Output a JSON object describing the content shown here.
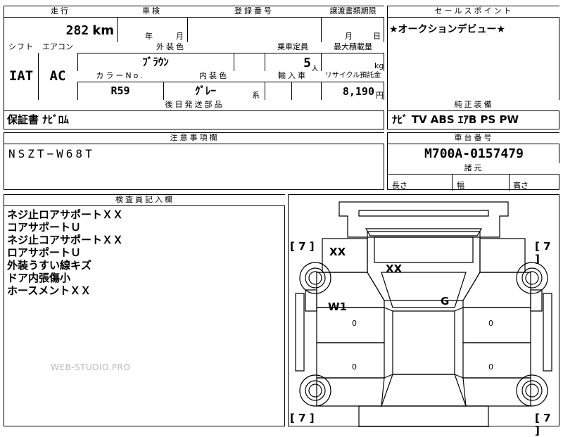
{
  "vehicle": {
    "headers": {
      "mileage": "走行",
      "inspection": "車検",
      "registration": "登録番号",
      "transfer": "譲渡書類期限",
      "shift": "シフト",
      "aircon": "エアコン",
      "exterior_color": "外装色",
      "capacity": "乗車定員",
      "max_load": "最大積載量",
      "color_no": "カラーNo.",
      "interior_color": "内装色",
      "import": "輸入車",
      "recycle": "リサイクル預託金",
      "later_parts": "後日発送部品"
    },
    "mileage": "282",
    "mileage_unit": "km",
    "inspection_year": "年",
    "inspection_month": "月",
    "transfer_month": "月",
    "transfer_day": "日",
    "shift": "IAT",
    "aircon": "AC",
    "exterior_color": "ﾌﾞﾗｳﾝ",
    "capacity": "5",
    "capacity_unit": "人",
    "load_unit": "kg",
    "color_no": "R59",
    "interior_color": "ｸﾞﾚｰ",
    "interior_suffix": "系",
    "recycle": "8,190",
    "recycle_unit": "円",
    "later_parts": "保証書 ﾅﾋﾞﾛﾑ"
  },
  "sales_point": {
    "header": "セールスポイント",
    "text": "★オークションデビュー★"
  },
  "equipment": {
    "header": "純正装備",
    "text": "ﾅﾋﾞ TV ABS ｴｱB PS PW"
  },
  "notes": {
    "header": "注意事項欄",
    "text": "NSZT−W68T"
  },
  "chassis": {
    "header": "車台番号",
    "value": "M700A-0157479"
  },
  "dimensions": {
    "header": "諸元",
    "length": "長さ",
    "width": "幅",
    "height": "高さ"
  },
  "inspector": {
    "header": "検査員記入欄",
    "lines": [
      "ネジ止ロアサポートＸＸ",
      "コアサポートＵ",
      "ネジ止コアサポートＸＸ",
      "ロアサポートＵ",
      "外装うすい線キズ",
      "ドア内張傷小",
      "ホースメントＸＸ"
    ]
  },
  "watermark": "WEB-STUDIO.PRO",
  "diagram": {
    "tire_label": "[ 7 ]",
    "marks": {
      "front_left": "XX",
      "hood": "XX",
      "left_door": "W1",
      "roof": "G"
    },
    "small_marks": [
      "0",
      "0",
      "0",
      "0"
    ]
  }
}
